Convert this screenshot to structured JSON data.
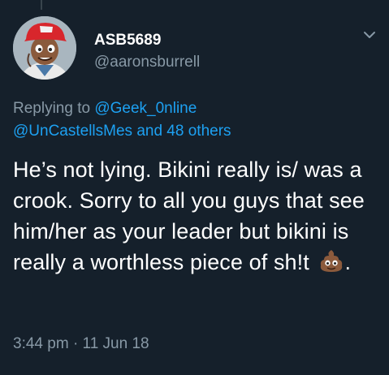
{
  "tweet": {
    "display_name": "ASB5689",
    "handle": "@aaronsburrell",
    "replying_prefix": "Replying to",
    "mention_1": "@Geek_0nline",
    "mention_2": "@UnCastellsMes",
    "others_text": "and 48 others",
    "text": "He’s not lying. Bikini really is/ was a crook. Sorry to all you guys that see him/her as your leader but bikini is really a worthless piece of sh!t",
    "text_suffix": ".",
    "emoji": "poop-emoji",
    "time": "3:44 pm",
    "separator": "·",
    "date": "11 Jun 18"
  },
  "icons": {
    "menu": "chevron-down-icon",
    "avatar": "cartoon-avatar"
  },
  "colors": {
    "background": "#15202b",
    "secondary_text": "#8899a6",
    "link": "#1da1f2"
  }
}
